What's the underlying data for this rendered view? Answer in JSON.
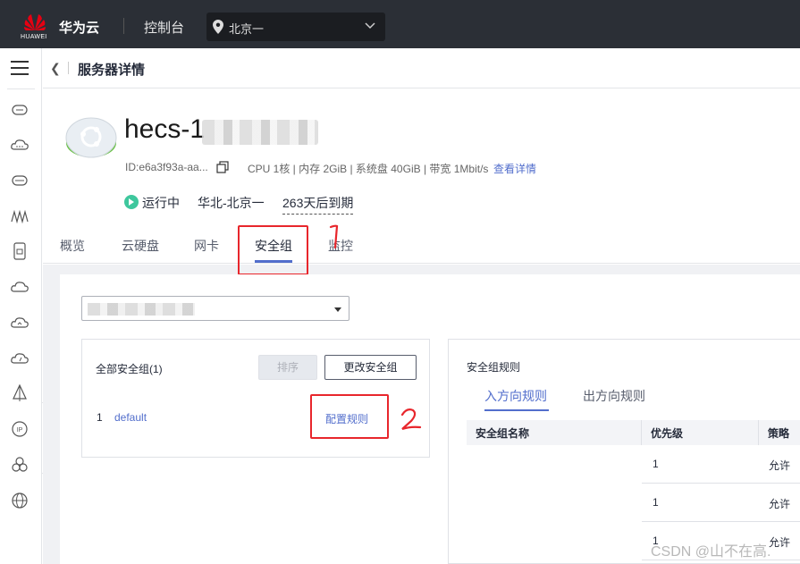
{
  "topbar": {
    "logo_text": "HUAWEI",
    "brand": "华为云",
    "console": "控制台",
    "region": "北京一"
  },
  "page": {
    "title": "服务器详情"
  },
  "server": {
    "hostname": "hecs-1",
    "id": "ID:e6a3f93a-aa...",
    "specs": "CPU 1核 | 内存 2GiB | 系统盘 40GiB | 带宽 1Mbit/s",
    "detail_link": "查看详情",
    "status": "运行中",
    "zone": "华北-北京一",
    "expire": "263天后到期"
  },
  "tabs": [
    "概览",
    "云硬盘",
    "网卡",
    "安全组",
    "监控"
  ],
  "security_groups": {
    "title": "全部安全组(1)",
    "sort_button": "排序",
    "change_button": "更改安全组",
    "items": [
      {
        "index": "1",
        "name": "default",
        "action": "配置规则"
      }
    ]
  },
  "rules": {
    "title": "安全组规则",
    "tabs": [
      "入方向规则",
      "出方向规则"
    ],
    "columns": [
      "安全组名称",
      "优先级",
      "策略"
    ],
    "rows": [
      {
        "priority": "1",
        "policy": "允许"
      },
      {
        "priority": "1",
        "policy": "允许"
      },
      {
        "priority": "1",
        "policy": "允许"
      }
    ]
  },
  "annotations": [
    "1",
    "2"
  ],
  "watermark": "CSDN @山不在高.",
  "colors": {
    "accent": "#526ecc",
    "topbar": "#2b2f36",
    "annotation": "#e8262c",
    "status_green": "#3ec79d"
  }
}
